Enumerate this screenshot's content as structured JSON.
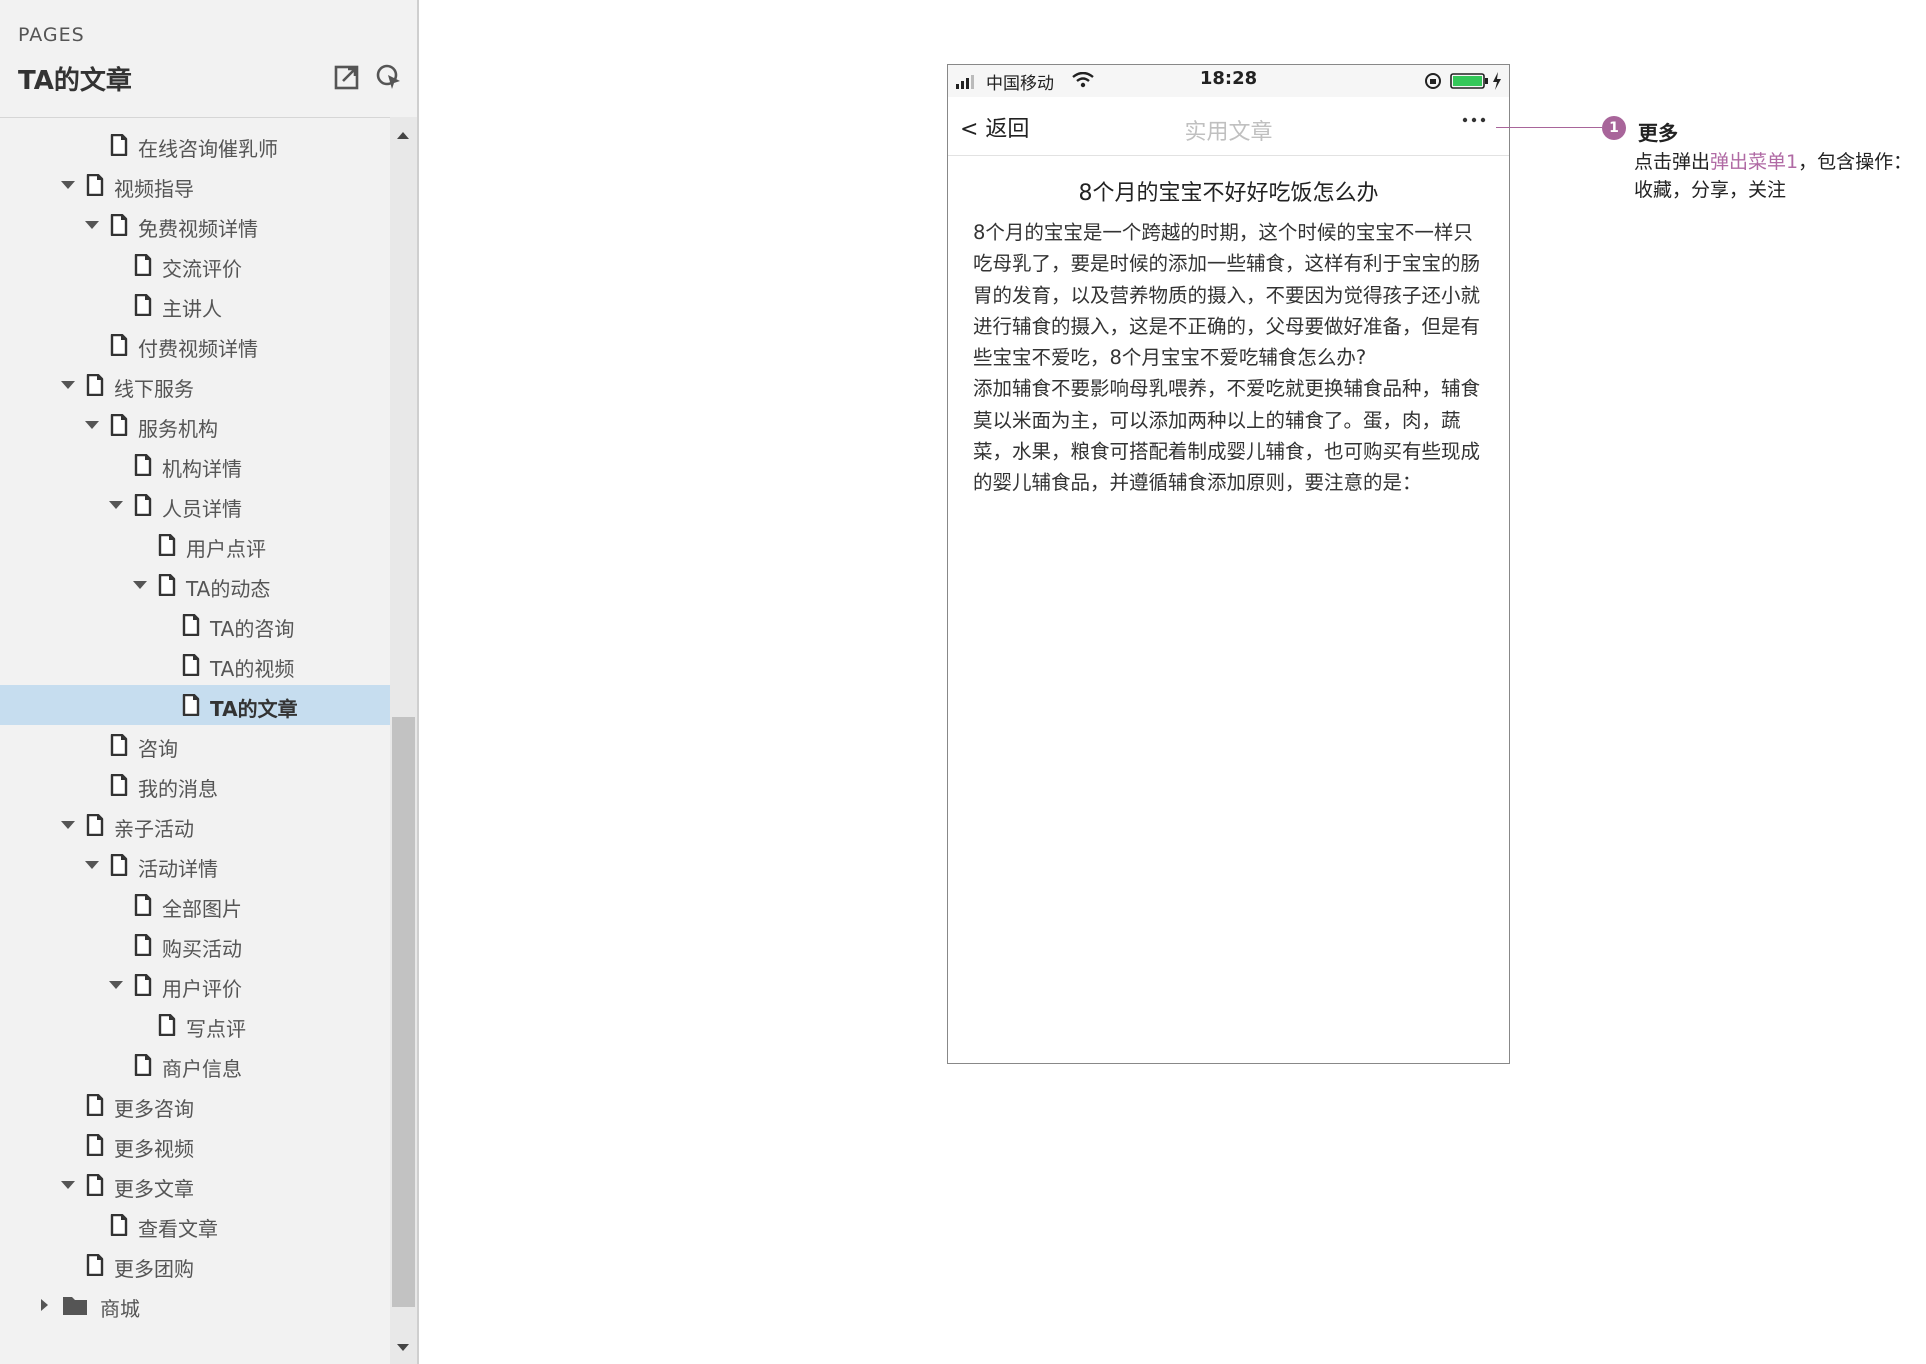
{
  "panel": {
    "label": "PAGES",
    "title": "TA的文章",
    "export_icon": "export-icon",
    "locate_icon": "locate-cursor-icon"
  },
  "tree": {
    "items": [
      {
        "label": "在线咨询催乳师",
        "level": 3,
        "expanded": null,
        "type": "page",
        "selected": false
      },
      {
        "label": "视频指导",
        "level": 2,
        "expanded": true,
        "type": "page",
        "selected": false
      },
      {
        "label": "免费视频详情",
        "level": 3,
        "expanded": true,
        "type": "page",
        "selected": false
      },
      {
        "label": "交流评价",
        "level": 4,
        "expanded": null,
        "type": "page",
        "selected": false
      },
      {
        "label": "主讲人",
        "level": 4,
        "expanded": null,
        "type": "page",
        "selected": false
      },
      {
        "label": "付费视频详情",
        "level": 3,
        "expanded": null,
        "type": "page",
        "selected": false
      },
      {
        "label": "线下服务",
        "level": 2,
        "expanded": true,
        "type": "page",
        "selected": false
      },
      {
        "label": "服务机构",
        "level": 3,
        "expanded": true,
        "type": "page",
        "selected": false
      },
      {
        "label": "机构详情",
        "level": 4,
        "expanded": null,
        "type": "page",
        "selected": false
      },
      {
        "label": "人员详情",
        "level": 4,
        "expanded": true,
        "type": "page",
        "selected": false
      },
      {
        "label": "用户点评",
        "level": 5,
        "expanded": null,
        "type": "page",
        "selected": false
      },
      {
        "label": "TA的动态",
        "level": 5,
        "expanded": true,
        "type": "page",
        "selected": false
      },
      {
        "label": "TA的咨询",
        "level": 6,
        "expanded": null,
        "type": "page",
        "selected": false
      },
      {
        "label": "TA的视频",
        "level": 6,
        "expanded": null,
        "type": "page",
        "selected": false
      },
      {
        "label": "TA的文章",
        "level": 6,
        "expanded": null,
        "type": "page",
        "selected": true
      },
      {
        "label": "咨询",
        "level": 3,
        "expanded": null,
        "type": "page",
        "selected": false
      },
      {
        "label": "我的消息",
        "level": 3,
        "expanded": null,
        "type": "page",
        "selected": false
      },
      {
        "label": "亲子活动",
        "level": 2,
        "expanded": true,
        "type": "page",
        "selected": false
      },
      {
        "label": "活动详情",
        "level": 3,
        "expanded": true,
        "type": "page",
        "selected": false
      },
      {
        "label": "全部图片",
        "level": 4,
        "expanded": null,
        "type": "page",
        "selected": false
      },
      {
        "label": "购买活动",
        "level": 4,
        "expanded": null,
        "type": "page",
        "selected": false
      },
      {
        "label": "用户评价",
        "level": 4,
        "expanded": true,
        "type": "page",
        "selected": false
      },
      {
        "label": "写点评",
        "level": 5,
        "expanded": null,
        "type": "page",
        "selected": false
      },
      {
        "label": "商户信息",
        "level": 4,
        "expanded": null,
        "type": "page",
        "selected": false
      },
      {
        "label": "更多咨询",
        "level": 2,
        "expanded": null,
        "type": "page",
        "selected": false
      },
      {
        "label": "更多视频",
        "level": 2,
        "expanded": null,
        "type": "page",
        "selected": false
      },
      {
        "label": "更多文章",
        "level": 2,
        "expanded": true,
        "type": "page",
        "selected": false
      },
      {
        "label": "查看文章",
        "level": 3,
        "expanded": null,
        "type": "page",
        "selected": false
      },
      {
        "label": "更多团购",
        "level": 2,
        "expanded": null,
        "type": "page",
        "selected": false
      },
      {
        "label": "商城",
        "level": 1,
        "expanded": false,
        "type": "folder",
        "selected": false
      }
    ]
  },
  "phone": {
    "status": {
      "carrier": "中国移动",
      "time": "18:28"
    },
    "nav": {
      "back": "< 返回",
      "title": "实用文章",
      "more": "···"
    },
    "article": {
      "title": "8个月的宝宝不好好吃饭怎么办",
      "paragraphs": [
        "8个月的宝宝是一个跨越的时期，这个时候的宝宝不一样只吃母乳了，要是时候的添加一些辅食，这样有利于宝宝的肠胃的发育，以及营养物质的摄入，不要因为觉得孩子还小就进行辅食的摄入，这是不正确的，父母要做好准备，但是有些宝宝不爱吃，8个月宝宝不爱吃辅食怎么办?",
        "添加辅食不要影响母乳喂养，不爱吃就更换辅食品种，辅食莫以米面为主，可以添加两种以上的辅食了。蛋，肉，蔬菜，水果，粮食可搭配着制成婴儿辅食，也可购买有些现成的婴儿辅食品，并遵循辅食添加原则，要注意的是："
      ]
    }
  },
  "annotation": {
    "number": "1",
    "title": "更多",
    "desc_before": "点击弹出",
    "link": "弹出菜单1",
    "desc_after": "，包含操作：收藏，分享，关注",
    "color": "#a8659a"
  },
  "colors": {
    "selected_row": "#c6ddef",
    "panel_bg": "#f2f2f2",
    "annotation_accent": "#a8659a"
  }
}
